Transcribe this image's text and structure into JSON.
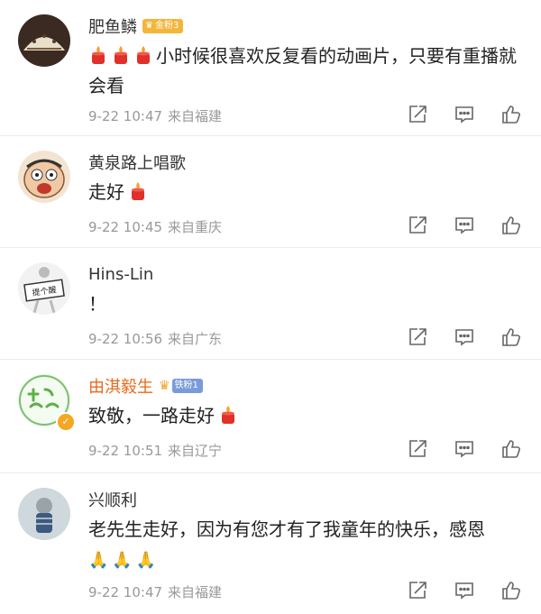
{
  "comments": [
    {
      "name": "肥鱼鳞",
      "badge": "金粉3",
      "text": "小时候很喜欢反复看的动画片，只要有重播就会看",
      "date": "9-22 10:47",
      "location": "来自福建"
    },
    {
      "name": "黄泉路上唱歌",
      "text": "走好",
      "date": "9-22 10:45",
      "location": "来自重庆"
    },
    {
      "name": "Hins-Lin",
      "text": "！",
      "avatar_text": "提个醒",
      "date": "9-22 10:56",
      "location": "来自广东"
    },
    {
      "name": "由淇毅生",
      "badge": "铁粉1",
      "text": "致敬，一路走好",
      "date": "9-22 10:51",
      "location": "来自辽宁"
    },
    {
      "name": "兴顺利",
      "text": "老先生走好，因为有您才有了我童年的快乐，感恩",
      "date": "9-22 10:47",
      "location": "来自福建"
    }
  ],
  "icons": {
    "candle": "candle-icon",
    "pray": "🙏",
    "share": "share-icon",
    "reply": "comment-icon",
    "like": "thumbs-up-icon",
    "verified": "✓"
  },
  "colors": {
    "name_vip": "#e96a1c",
    "meta": "#999999",
    "badge_gold": "#f3b53a",
    "badge_iron": "#7a9bd9"
  }
}
